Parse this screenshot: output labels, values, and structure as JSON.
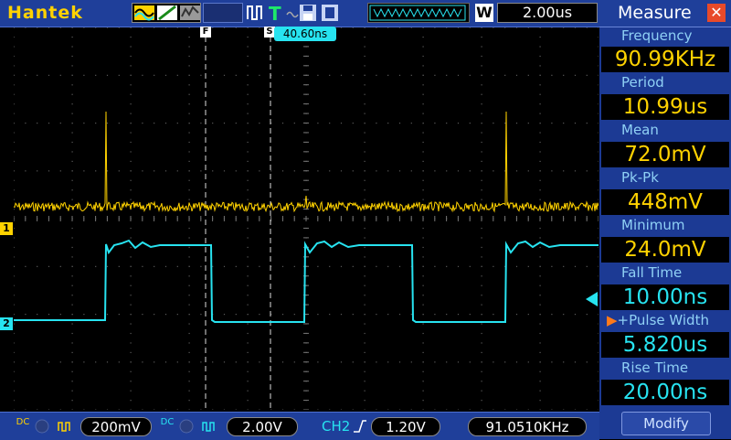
{
  "topbar": {
    "brand": "Hantek",
    "trigger_letter": "T",
    "timebase_label": "W",
    "time_delay": "2.00us",
    "time_offset_flag": "40.60ns",
    "cursor_f_label": "F",
    "cursor_s_label": "S"
  },
  "measure": {
    "title": "Measure",
    "items": [
      {
        "label": "Frequency",
        "value": "90.99KHz"
      },
      {
        "label": "Period",
        "value": "10.99us"
      },
      {
        "label": "Mean",
        "value": "72.0mV"
      },
      {
        "label": "Pk-Pk",
        "value": "448mV"
      },
      {
        "label": "Minimum",
        "value": "24.0mV"
      },
      {
        "label": "Fall Time",
        "value": "10.00ns"
      },
      {
        "label": "+Pulse Width",
        "value": "5.820us"
      },
      {
        "label": "Rise Time",
        "value": "20.00ns"
      }
    ],
    "modify_label": "Modify"
  },
  "bottombar": {
    "ch1_coupling": "DC",
    "ch1_volts": "200mV",
    "ch2_coupling": "DC",
    "ch2_volts": "2.00V",
    "trigger_source": "CH2",
    "trigger_level": "1.20V",
    "trigger_frequency": "91.0510KHz"
  },
  "channels": {
    "ch1_marker": "1",
    "ch2_marker": "2"
  },
  "colors": {
    "ch1": "#ffd200",
    "ch2": "#27e3f0",
    "panel": "#1c3a94",
    "header": "#1f3f9a",
    "grid_dot": "#5a5a5a"
  }
}
